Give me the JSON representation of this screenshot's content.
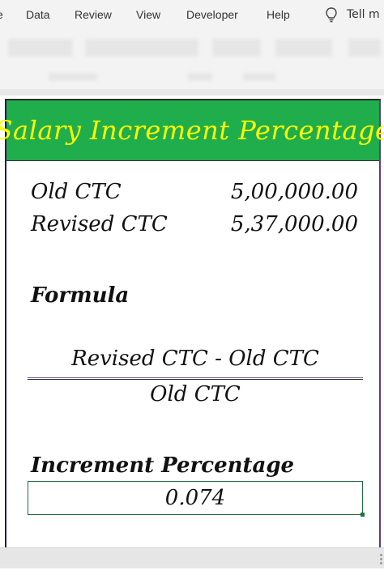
{
  "ribbon": {
    "tabs": [
      {
        "id": "partial",
        "label": "e"
      },
      {
        "id": "data",
        "label": "Data"
      },
      {
        "id": "review",
        "label": "Review"
      },
      {
        "id": "view",
        "label": "View"
      },
      {
        "id": "developer",
        "label": "Developer"
      },
      {
        "id": "help",
        "label": "Help"
      }
    ],
    "tell_me": "Tell m",
    "tell_icon": "lightbulb-icon"
  },
  "sheet": {
    "title": "Salary Increment Percentage",
    "title_bg": "#1fae4b",
    "title_color": "#ffff00",
    "old_ctc_label": "Old CTC",
    "old_ctc_value": "5,00,000.00",
    "revised_ctc_label": "Revised CTC",
    "revised_ctc_value": "5,37,000.00",
    "formula_label": "Formula",
    "numerator": "Revised CTC - Old CTC",
    "denominator": "Old CTC",
    "result_label": "Increment Percentage",
    "result_value": "0.074"
  }
}
